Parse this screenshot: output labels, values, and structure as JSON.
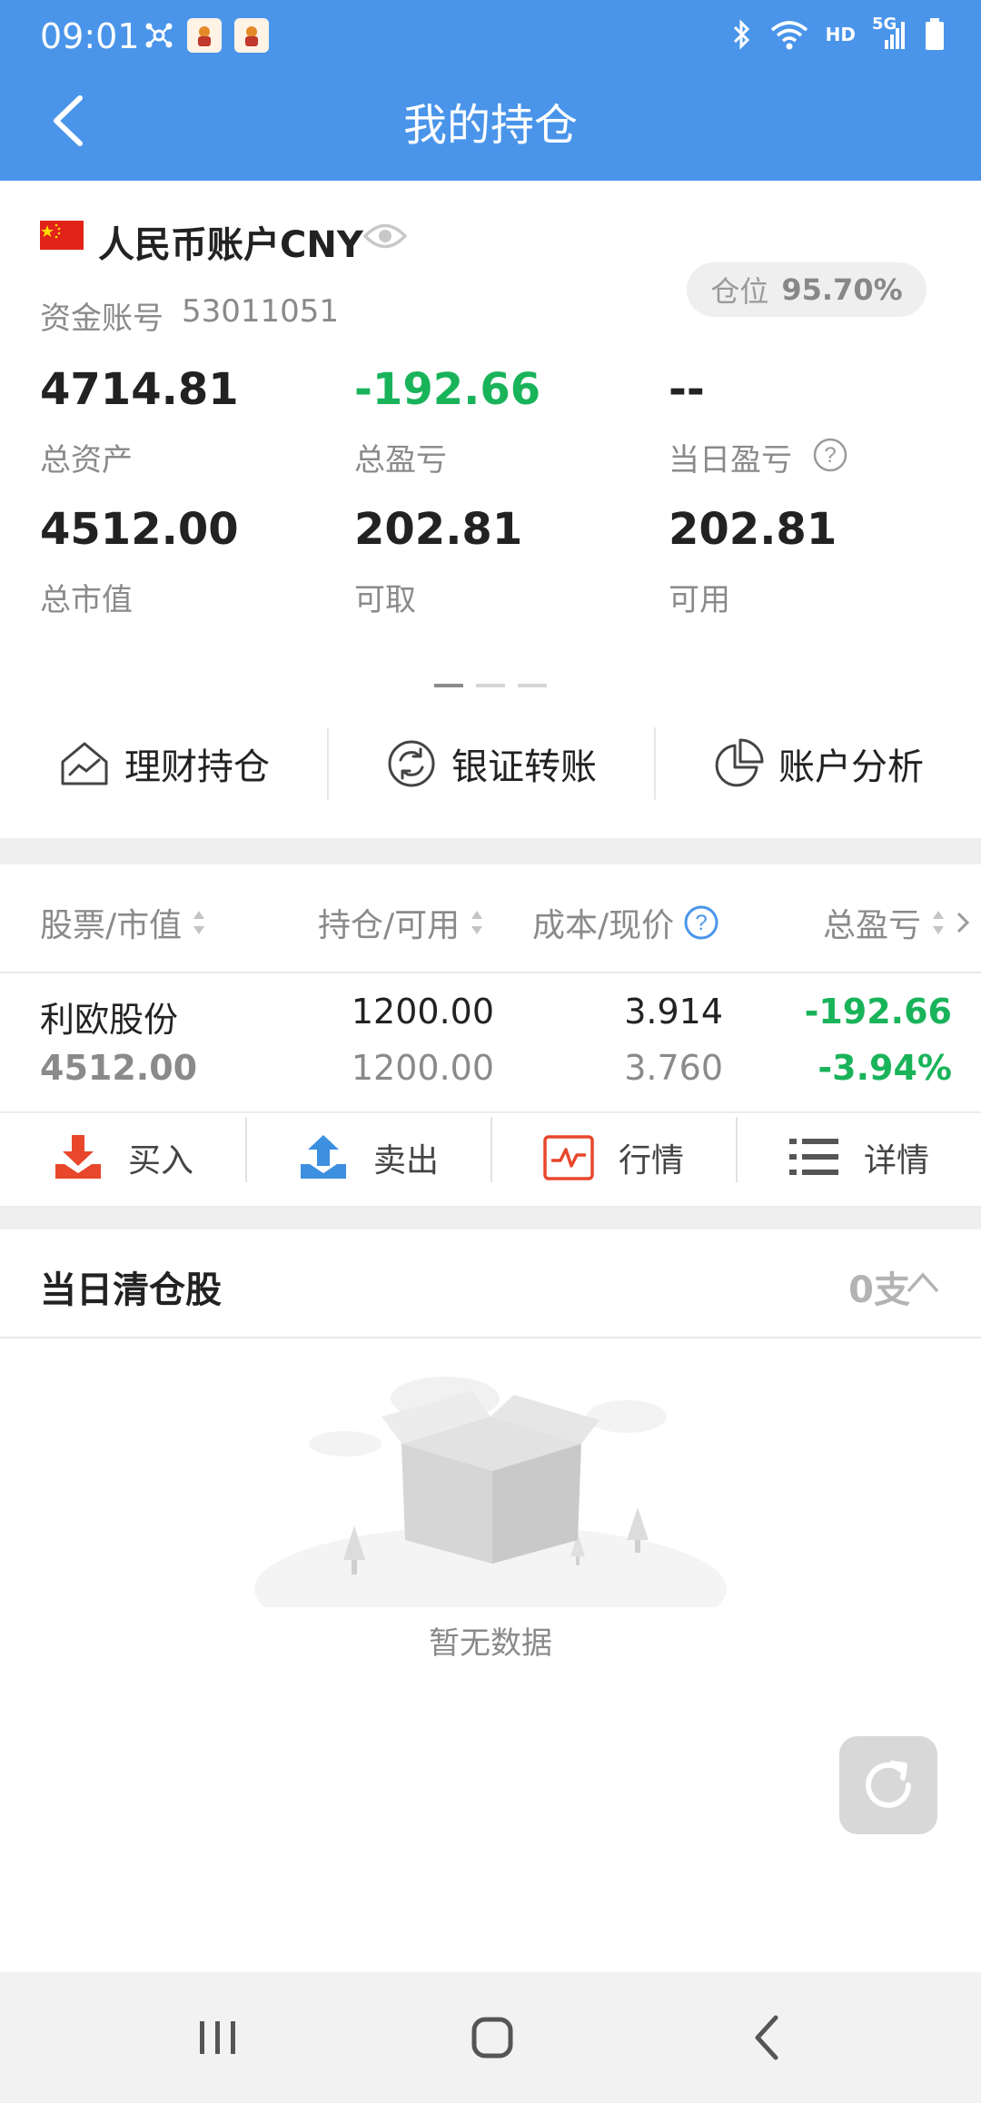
{
  "status_bar": {
    "time": "09:01",
    "network": "5G",
    "hd": "HD",
    "icons": [
      "network-hub-icon",
      "app-notification-icon",
      "app-notification-icon",
      "bluetooth-icon",
      "wifi-icon",
      "signal-icon",
      "battery-icon"
    ]
  },
  "header": {
    "title": "我的持仓",
    "background": "#4a95ea"
  },
  "account": {
    "name": "人民币账户CNY",
    "id_label": "资金账号",
    "id": "53011051",
    "position_label": "仓位",
    "position_value": "95.70%",
    "stats": [
      {
        "value": "4714.81",
        "label": "总资产",
        "color": "#222222"
      },
      {
        "value": "-192.66",
        "label": "总盈亏",
        "color": "#19b35a"
      },
      {
        "value": "--",
        "label": "当日盈亏",
        "color": "#222222"
      },
      {
        "value": "4512.00",
        "label": "总市值",
        "color": "#222222"
      },
      {
        "value": "202.81",
        "label": "可取",
        "color": "#222222"
      },
      {
        "value": "202.81",
        "label": "可用",
        "color": "#222222"
      }
    ],
    "pager_total": 3,
    "pager_active": 1
  },
  "quick_actions": [
    {
      "label": "理财持仓",
      "icon": "house-chart-icon"
    },
    {
      "label": "银证转账",
      "icon": "transfer-cycle-icon"
    },
    {
      "label": "账户分析",
      "icon": "pie-chart-icon"
    }
  ],
  "holdings_table": {
    "columns": [
      "股票/市值",
      "持仓/可用",
      "成本/现价",
      "总盈亏"
    ],
    "rows": [
      {
        "name": "利欧股份",
        "market_value": "4512.00",
        "holding": "1200.00",
        "available": "1200.00",
        "cost": "3.914",
        "price": "3.760",
        "pnl": "-192.66",
        "pnl_pct": "-3.94%"
      }
    ]
  },
  "row_actions": [
    {
      "label": "买入",
      "icon": "buy-download-icon"
    },
    {
      "label": "卖出",
      "icon": "sell-upload-icon"
    },
    {
      "label": "行情",
      "icon": "market-chart-icon"
    },
    {
      "label": "详情",
      "icon": "list-details-icon"
    }
  ],
  "cleared": {
    "title": "当日清仓股",
    "count": "0支"
  },
  "empty_state": {
    "text": "暂无数据"
  },
  "colors": {
    "gain_green": "#19b35a",
    "accent_blue": "#4a95ea",
    "buy_red": "#e8472c",
    "sell_blue": "#3d8fe0"
  }
}
